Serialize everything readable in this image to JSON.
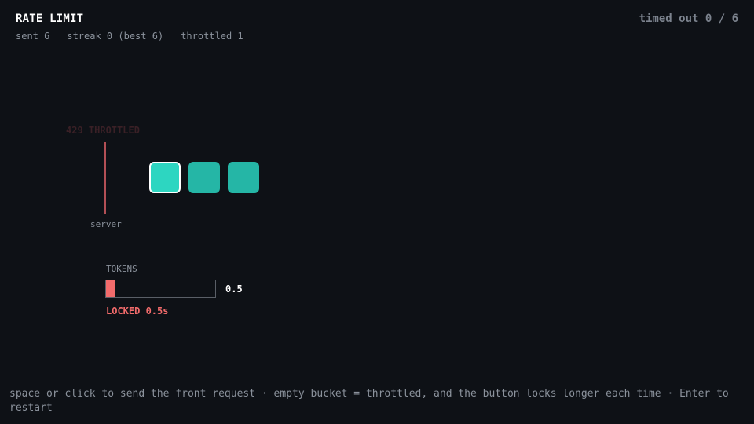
{
  "header": {
    "title": "RATE LIMIT",
    "timed_out": "timed out 0 / 6"
  },
  "stats": {
    "sent": "sent 6",
    "streak": "streak 0 (best 6)",
    "throttled": "throttled 1"
  },
  "server": {
    "status_text": "429 THROTTLED",
    "label": "server",
    "line_color": "#b24f55"
  },
  "queue": {
    "request_count": 3,
    "front_color": "#2dd6c1",
    "request_color": "#25b6a6"
  },
  "bucket": {
    "label": "TOKENS",
    "value": "0.5",
    "fill_fraction": 0.08,
    "fill_color": "#f26b6b",
    "locked_text": "LOCKED 0.5s"
  },
  "footer": {
    "help": "space or click to send the front request · empty bucket = throttled, and the button locks longer each time · Enter to restart"
  },
  "colors": {
    "background": "#0e1116",
    "accent_red": "#f26b6b",
    "accent_teal": "#2dd6c1"
  }
}
